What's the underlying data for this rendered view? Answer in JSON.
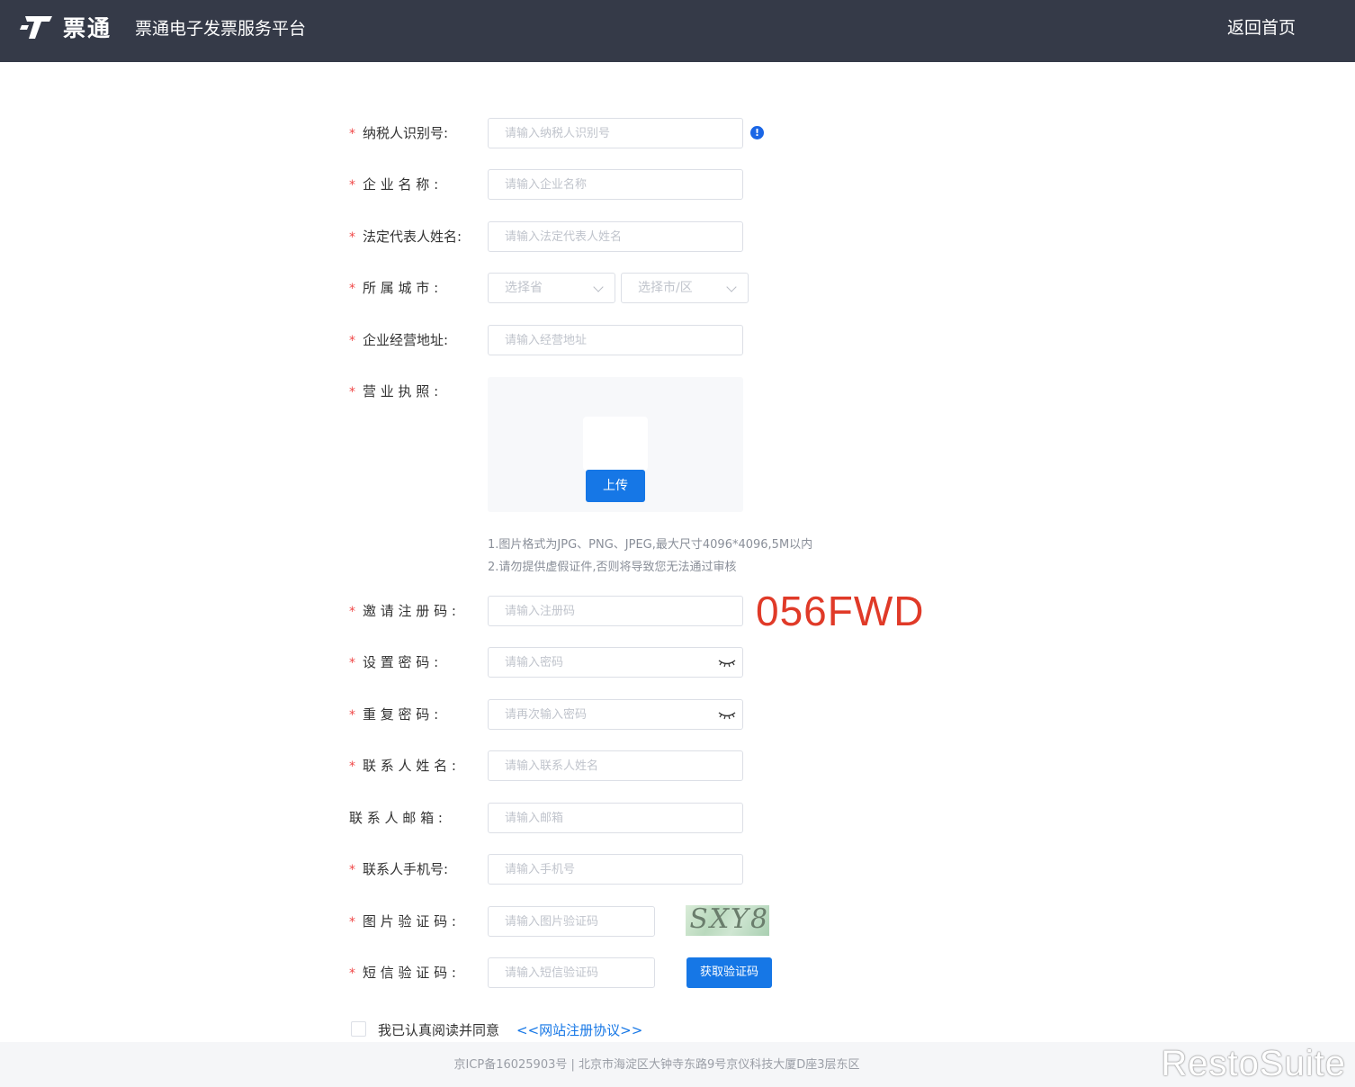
{
  "header": {
    "brand": "票通",
    "platform_title": "票通电子发票服务平台",
    "home_link": "返回首页"
  },
  "form": {
    "taxpayer_id": {
      "label": "纳税人识别号:",
      "placeholder": "请输入纳税人识别号"
    },
    "company_name": {
      "label": "企 业 名 称 :",
      "placeholder": "请输入企业名称"
    },
    "legal_rep": {
      "label": "法定代表人姓名:",
      "placeholder": "请输入法定代表人姓名"
    },
    "city": {
      "label": "所 属 城 市 :",
      "province_placeholder": "选择省",
      "city_placeholder": "选择市/区"
    },
    "address": {
      "label": "企业经营地址:",
      "placeholder": "请输入经营地址"
    },
    "license": {
      "label": "营 业 执 照 :",
      "upload_button": "上传",
      "note_1": "1.图片格式为JPG、PNG、JPEG,最大尺寸4096*4096,5M以内",
      "note_2": "2.请勿提供虚假证件,否则将导致您无法通过审核"
    },
    "invite_code": {
      "label": "邀 请 注 册 码 :",
      "placeholder": "请输入注册码"
    },
    "password": {
      "label": "设 置 密 码 :",
      "placeholder": "请输入密码"
    },
    "password_repeat": {
      "label": "重 复 密 码 :",
      "placeholder": "请再次输入密码"
    },
    "contact_name": {
      "label": "联 系 人 姓 名 :",
      "placeholder": "请输入联系人姓名"
    },
    "contact_email": {
      "label": "联 系 人 邮 箱 :",
      "placeholder": "请输入邮箱"
    },
    "contact_phone": {
      "label": "联系人手机号:",
      "placeholder": "请输入手机号"
    },
    "image_captcha": {
      "label": "图 片 验 证 码 :",
      "placeholder": "请输入图片验证码",
      "captcha_text": "SXY8"
    },
    "sms_code": {
      "label": "短 信 验 证 码 :",
      "placeholder": "请输入短信验证码",
      "button": "获取验证码"
    },
    "agreement": {
      "text": "我已认真阅读并同意",
      "link": "<<网站注册协议>>"
    }
  },
  "annotation": "056FWD",
  "footer": {
    "text": "京ICP备16025903号 | 北京市海淀区大钟寺东路9号京仪科技大厦D座3层东区"
  },
  "watermark": "RestoSuite",
  "colors": {
    "header_bg": "#353a48",
    "primary": "#1677e6",
    "required": "#f04848",
    "annotation": "#e03a28"
  }
}
